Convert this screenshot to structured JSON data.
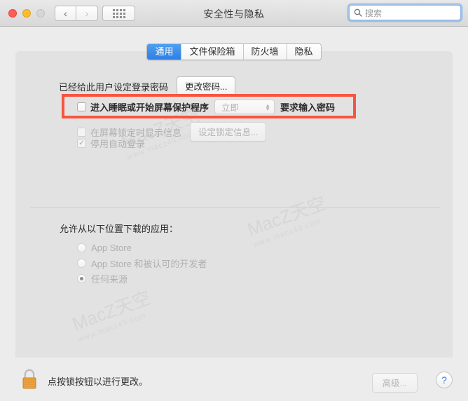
{
  "window": {
    "title": "安全性与隐私",
    "traffic_lights": [
      "close",
      "minimize",
      "zoom"
    ],
    "nav_back_icon": "chevron-left-icon",
    "nav_forward_icon": "chevron-right-icon",
    "show_all_icon": "grid-dots-icon"
  },
  "search": {
    "placeholder": "搜索",
    "icon": "search-icon",
    "value": ""
  },
  "tabs": [
    {
      "label": "通用",
      "active": true
    },
    {
      "label": "文件保险箱",
      "active": false
    },
    {
      "label": "防火墙",
      "active": false
    },
    {
      "label": "隐私",
      "active": false
    }
  ],
  "general": {
    "password_status": "已经给此用户设定登录密码",
    "change_password_button": "更改密码...",
    "require_password": {
      "checkbox_checked": false,
      "label_before": "进入睡眠或开始屏幕保护程序",
      "delay_value": "立即",
      "label_after": "要求输入密码",
      "highlight_color": "#f8543f"
    },
    "show_lock_message": {
      "checkbox_checked": false,
      "label": "在屏幕锁定时显示信息",
      "button": "设定锁定信息..."
    },
    "disable_auto_login": {
      "checkbox_checked": true,
      "check_glyph": "✓",
      "label": "停用自动登录"
    }
  },
  "downloads": {
    "title": "允许从以下位置下载的应用：",
    "options": [
      {
        "label": "App Store",
        "selected": false
      },
      {
        "label": "App Store 和被认可的开发者",
        "selected": false
      },
      {
        "label": "任何来源",
        "selected": true
      }
    ]
  },
  "footer": {
    "lock_icon": "lock-closed-icon",
    "lock_message": "点按锁按钮以进行更改。",
    "advanced_button": "高级...",
    "help_button": "?",
    "help_icon": "question-mark-icon"
  },
  "watermarks": [
    {
      "text": "MacZ天空",
      "sub": "www.macz49.com"
    },
    {
      "text": "MacZ天空",
      "sub": "www.macz49.com"
    },
    {
      "text": "MacZ天空",
      "sub": "www.macz49.com"
    }
  ]
}
